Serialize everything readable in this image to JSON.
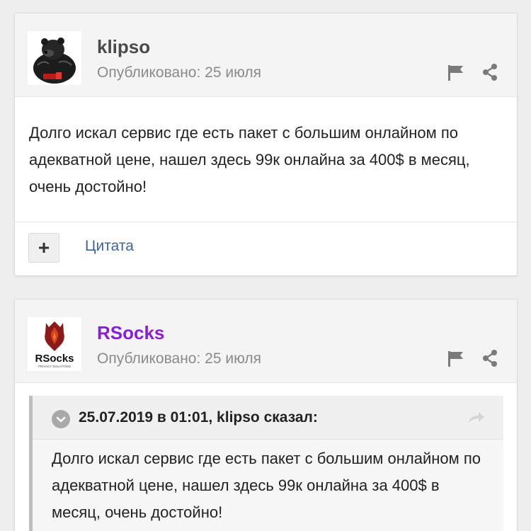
{
  "posts": [
    {
      "author": "klipso",
      "published": "Опубликовано: 25 июля",
      "body": "Долго искал сервис где есть пакет с большим онлайном по адекватной цене, нашел здесь 99к онлайна за 400$ в месяц, очень достойно!",
      "footer": {
        "plus_label": "+",
        "quote_label": "Цитата"
      }
    },
    {
      "author": "RSocks",
      "published": "Опубликовано: 25 июля",
      "avatar_text": "RSocks",
      "avatar_tagline": "PRIVACY SOLUTIONS",
      "quote": {
        "citation": "25.07.2019 в 01:01, klipso сказал:",
        "text": "Долго искал сервис где есть пакет с большим онлайном по адекватной цене, нашел здесь 99к онлайна за 400$ в месяц, очень достойно!"
      }
    }
  ],
  "icons": {
    "flag": "flag-icon",
    "share": "share-icon",
    "quote_toggle": "chevron-down-circle-icon",
    "quote_goto": "arrow-forward-icon"
  },
  "colors": {
    "brand_author": "#8a1fd0",
    "link": "#3d6594",
    "icon_gray": "#7a7a7a"
  }
}
